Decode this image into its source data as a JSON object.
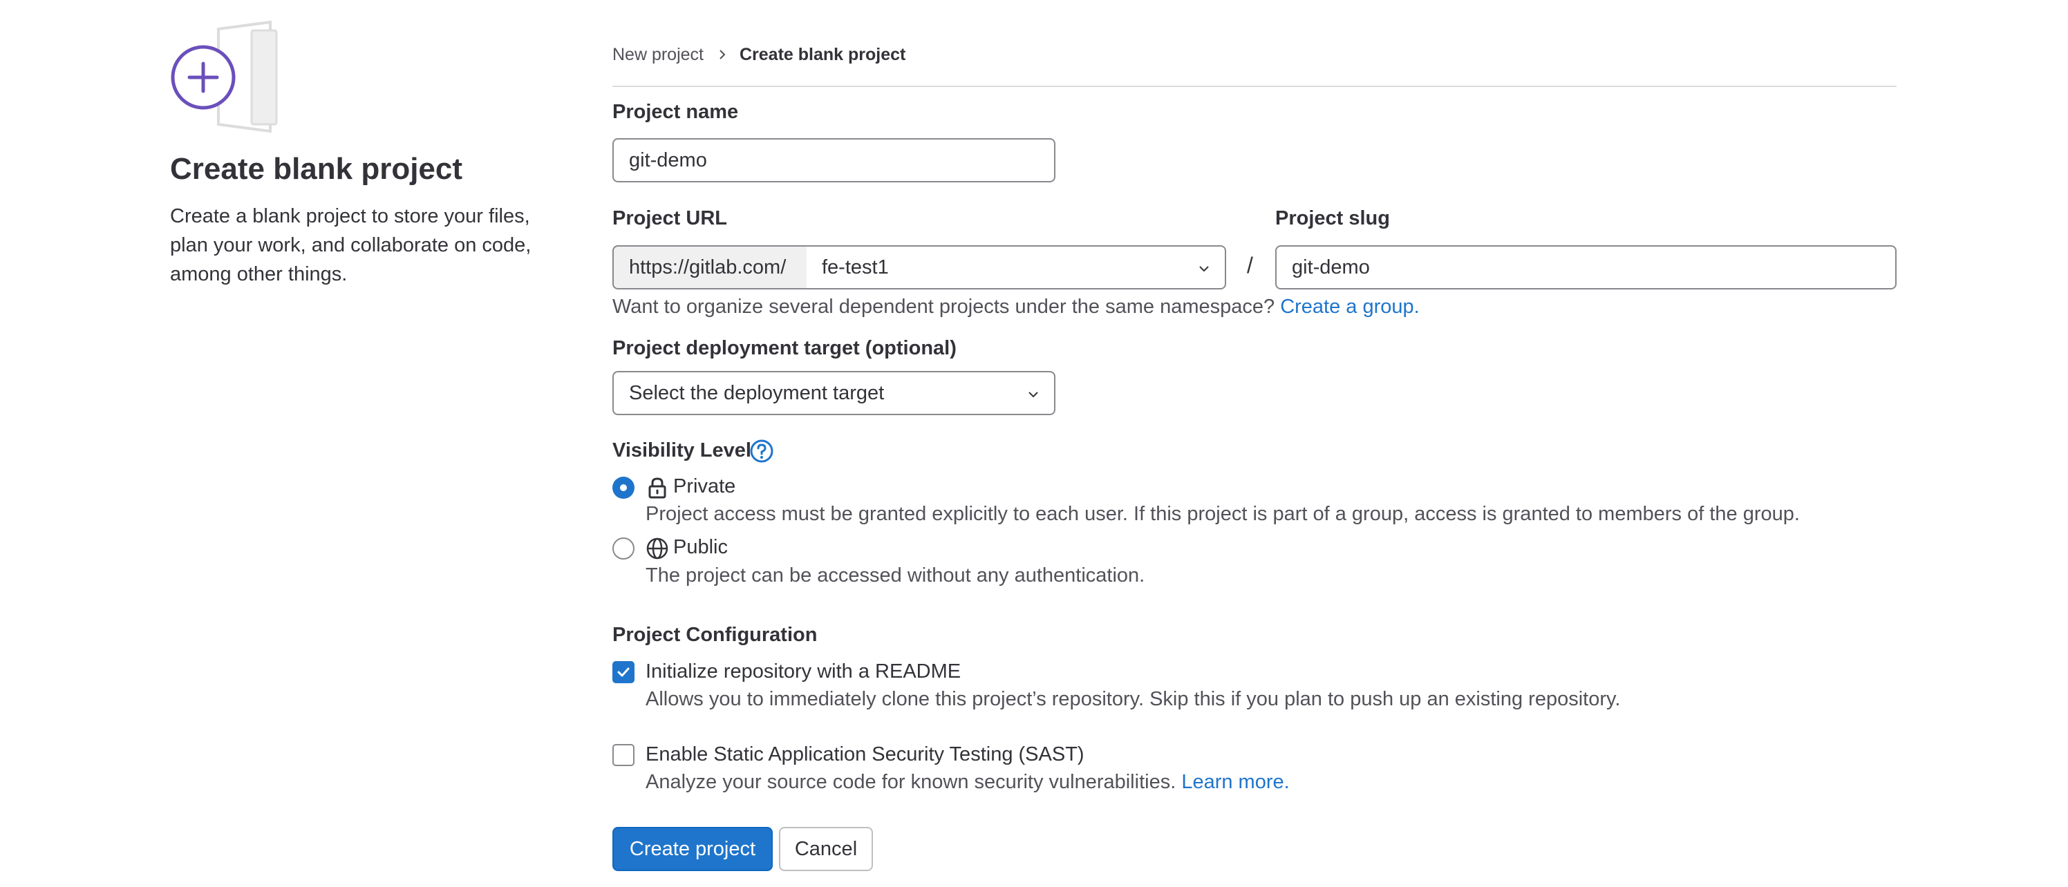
{
  "sidebar": {
    "title": "Create blank project",
    "description": "Create a blank project to store your files, plan your work, and collaborate on code, among other things."
  },
  "breadcrumb": {
    "items": [
      "New project",
      "Create blank project"
    ]
  },
  "form": {
    "project_name": {
      "label": "Project name",
      "value": "git-demo"
    },
    "project_url": {
      "label": "Project URL",
      "prefix": "https://gitlab.com/",
      "namespace": "fe-test1",
      "separator": "/"
    },
    "project_slug": {
      "label": "Project slug",
      "value": "git-demo"
    },
    "namespace_help": {
      "text": "Want to organize several dependent projects under the same namespace?",
      "link": "Create a group."
    },
    "deployment_target": {
      "label": "Project deployment target (optional)",
      "placeholder": "Select the deployment target"
    },
    "visibility": {
      "label": "Visibility Level",
      "options": [
        {
          "label": "Private",
          "help": "Project access must be granted explicitly to each user. If this project is part of a group, access is granted to members of the group.",
          "selected": true,
          "icon": "lock-icon"
        },
        {
          "label": "Public",
          "help": "The project can be accessed without any authentication.",
          "selected": false,
          "icon": "globe-icon"
        }
      ]
    },
    "configuration": {
      "label": "Project Configuration",
      "readme": {
        "label": "Initialize repository with a README",
        "help": "Allows you to immediately clone this project’s repository. Skip this if you plan to push up an existing repository.",
        "checked": true
      },
      "sast": {
        "label": "Enable Static Application Security Testing (SAST)",
        "help": "Analyze your source code for known security vulnerabilities.",
        "link": "Learn more.",
        "checked": false
      }
    },
    "buttons": {
      "create": "Create project",
      "cancel": "Cancel"
    }
  },
  "colors": {
    "accent": "#1f75cb",
    "illustration": "#6b4fbb",
    "text": "#333238",
    "muted": "#535158"
  }
}
